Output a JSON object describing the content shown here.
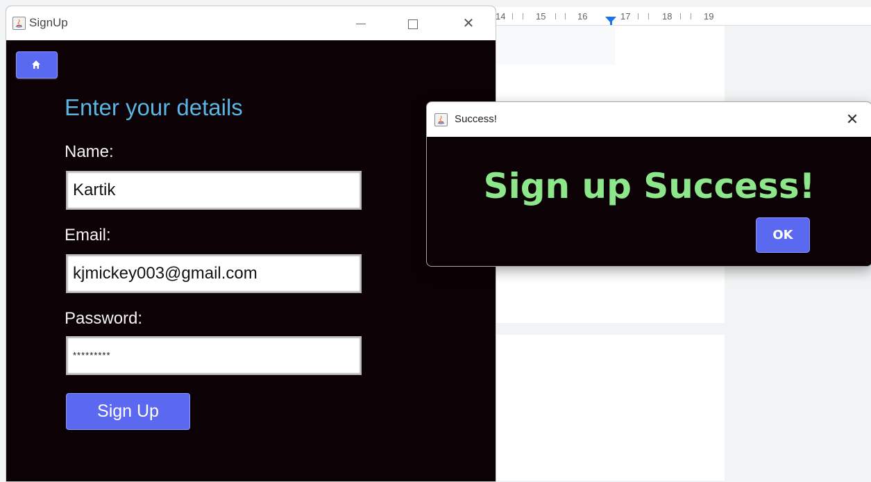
{
  "ruler": {
    "numbers": [
      "14",
      "15",
      "16",
      "17",
      "18",
      "19"
    ]
  },
  "signup_window": {
    "title": "SignUp",
    "home_icon": "home-icon",
    "heading": "Enter your details",
    "fields": [
      {
        "label": "Name:",
        "value": "Kartik"
      },
      {
        "label": "Email:",
        "value": "kjmickey003@gmail.com"
      },
      {
        "label": "Password:",
        "value": "*********"
      }
    ],
    "submit_label": "Sign Up"
  },
  "success_dialog": {
    "title": "Success!",
    "message": "Sign up Success!",
    "ok_label": "OK"
  },
  "colors": {
    "window_bg": "#0c0205",
    "heading": "#5bb5e2",
    "button": "#5b68f0",
    "success_text": "#8de68a"
  }
}
